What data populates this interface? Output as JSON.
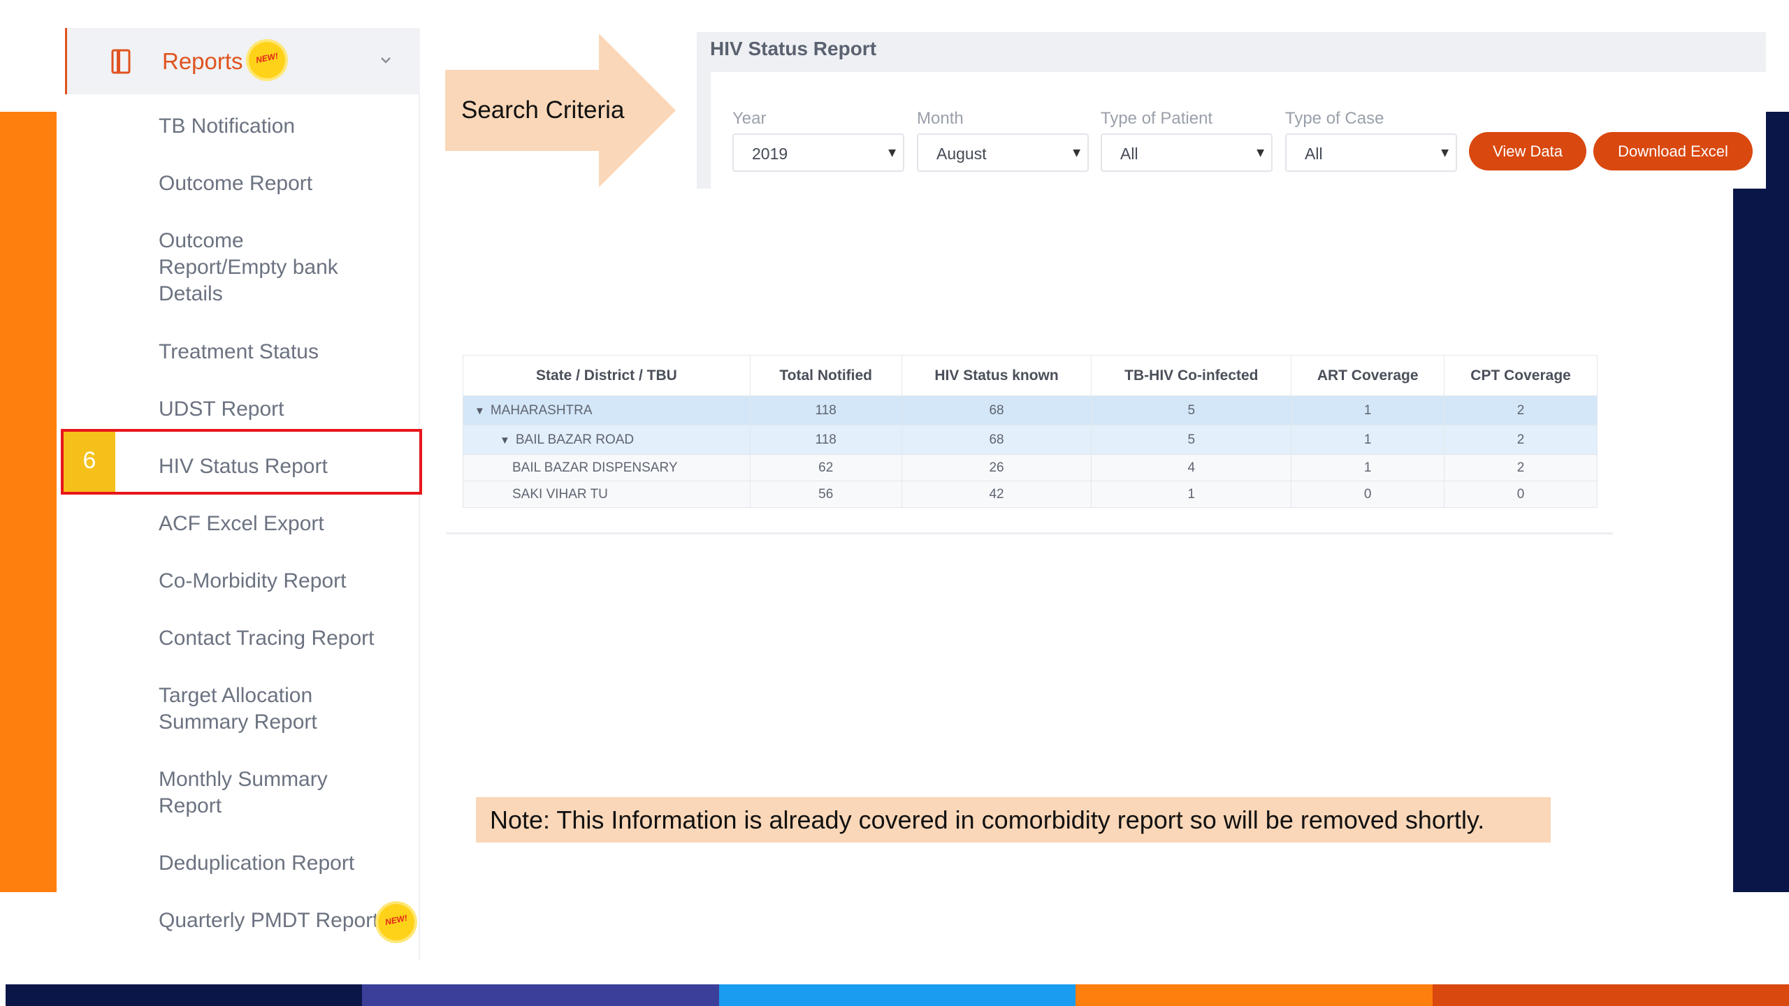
{
  "sidebar": {
    "header_label": "Reports",
    "badge_text": "NEW!",
    "items": [
      "TB Notification",
      "Outcome Report",
      "Outcome Report/Empty bank Details",
      "Treatment Status",
      "UDST Report",
      "HIV Status Report",
      "ACF Excel Export",
      "Co-Morbidity Report",
      "Contact Tracing Report",
      "Target Allocation Summary Report",
      "Monthly Summary Report",
      "Deduplication Report",
      "Quarterly PMDT Report"
    ]
  },
  "annotation": {
    "step_number": "6",
    "arrow_label": "Search Criteria",
    "highlight_color": "#e8161b"
  },
  "panel": {
    "title": "HIV Status Report",
    "filters": [
      {
        "label": "Year",
        "value": "2019"
      },
      {
        "label": "Month",
        "value": "August"
      },
      {
        "label": "Type of Patient",
        "value": "All"
      },
      {
        "label": "Type of Case",
        "value": "All"
      }
    ],
    "buttons": {
      "view": "View Data",
      "download": "Download Excel"
    }
  },
  "table": {
    "headers": [
      "State / District / TBU",
      "Total Notified",
      "HIV Status known",
      "TB-HIV Co-infected",
      "ART Coverage",
      "CPT Coverage"
    ],
    "rows": [
      {
        "name": "MAHARASHTRA",
        "cells": [
          "118",
          "68",
          "5",
          "1",
          "2"
        ]
      },
      {
        "name": "BAIL BAZAR ROAD",
        "cells": [
          "118",
          "68",
          "5",
          "1",
          "2"
        ]
      },
      {
        "name": "BAIL BAZAR DISPENSARY",
        "cells": [
          "62",
          "26",
          "4",
          "1",
          "2"
        ]
      },
      {
        "name": "SAKI VIHAR TU",
        "cells": [
          "56",
          "42",
          "1",
          "0",
          "0"
        ]
      }
    ]
  },
  "note": {
    "text": "Note: This Information is already covered in comorbidity report so will be removed shortly."
  },
  "colors": {
    "accent": "#e0531f",
    "button": "#d9480f",
    "left_bar": "#ff7f0e",
    "right_bar": "#0b1648",
    "bottom_strip": [
      "#0b1648",
      "#3b3f9a",
      "#1a9cf0",
      "#ff7f0e",
      "#d9480f"
    ]
  }
}
